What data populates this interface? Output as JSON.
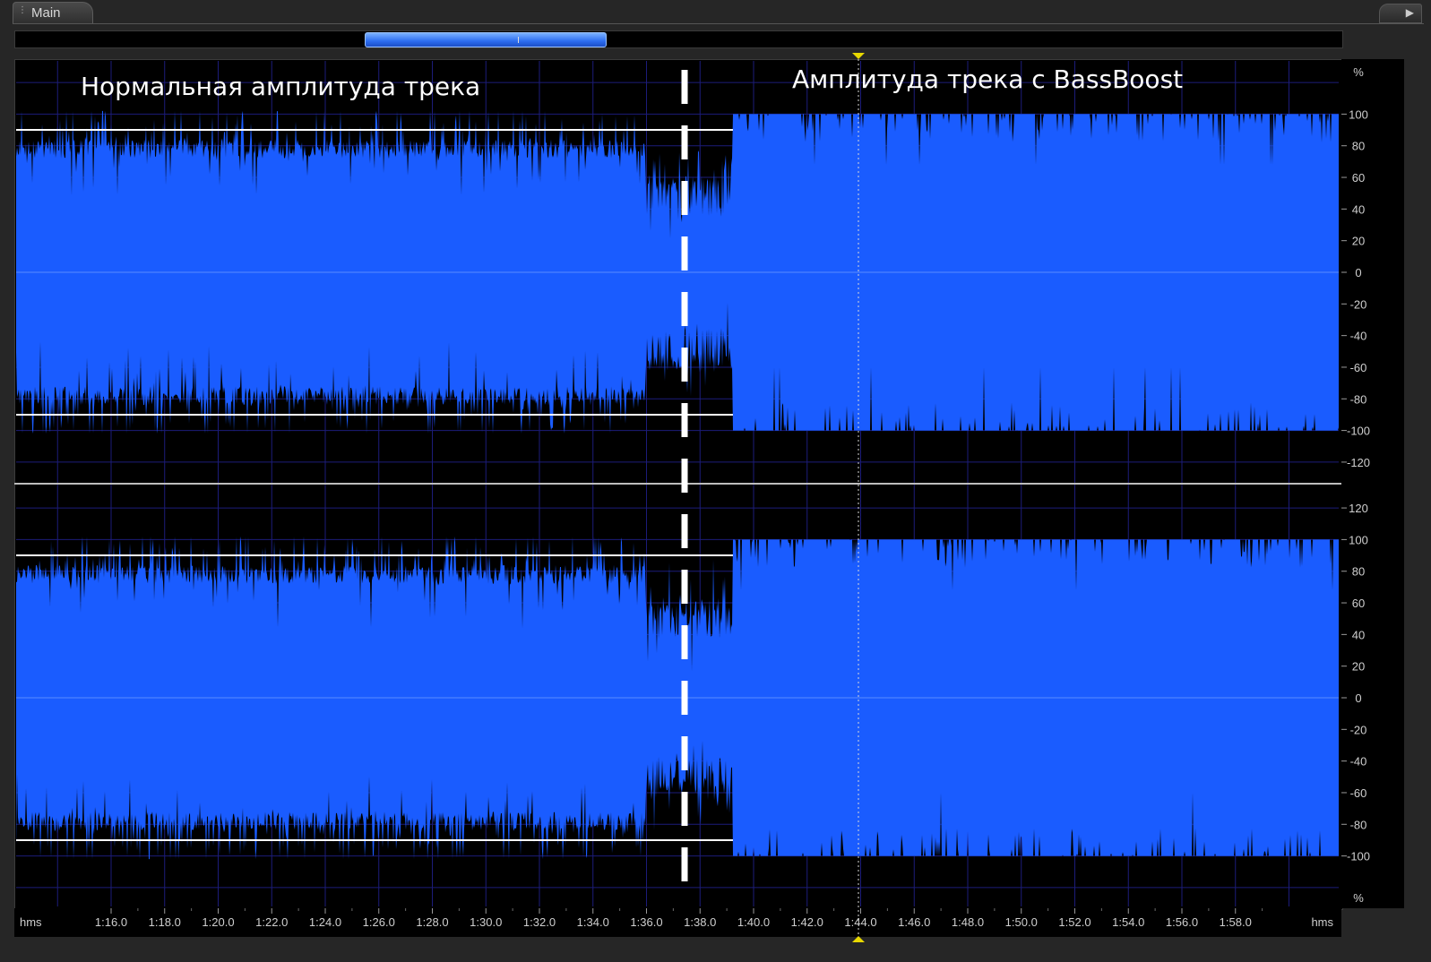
{
  "window": {
    "tab_label": "Main",
    "corner_icon": "play-triangle-icon"
  },
  "overlay": {
    "left_label": "Нормальная амплитуда трека",
    "right_label": "Амплитуда трека с BassBoost"
  },
  "ruler": {
    "unit": "%",
    "upper_ticks": [
      "100",
      "80",
      "60",
      "40",
      "20",
      "0",
      "-20",
      "-40",
      "-60",
      "-80",
      "-100",
      "-120"
    ],
    "lower_ticks": [
      "120",
      "100",
      "80",
      "60",
      "40",
      "20",
      "0",
      "-20",
      "-40",
      "-60",
      "-80",
      "-100"
    ]
  },
  "timeline": {
    "unit_left": "hms",
    "unit_right": "hms",
    "labels": [
      "1:16.0",
      "1:18.0",
      "1:20.0",
      "1:22.0",
      "1:24.0",
      "1:26.0",
      "1:28.0",
      "1:30.0",
      "1:32.0",
      "1:34.0",
      "1:36.0",
      "1:38.0",
      "1:40.0",
      "1:42.0",
      "1:44.0",
      "1:46.0",
      "1:48.0",
      "1:50.0",
      "1:52.0",
      "1:54.0",
      "1:56.0",
      "1:58.0"
    ]
  },
  "colors": {
    "waveform": "#1a5cff",
    "waveform_bright": "#2d6bff",
    "background": "#000000",
    "grid": "#1c1c7a",
    "cursor_marker": "#e8d800"
  },
  "waveform": {
    "boost_start_time": "1:39.4",
    "cursor_time": "1:44.0",
    "normal_level_percent": 90,
    "boosted_level_percent": 100
  }
}
